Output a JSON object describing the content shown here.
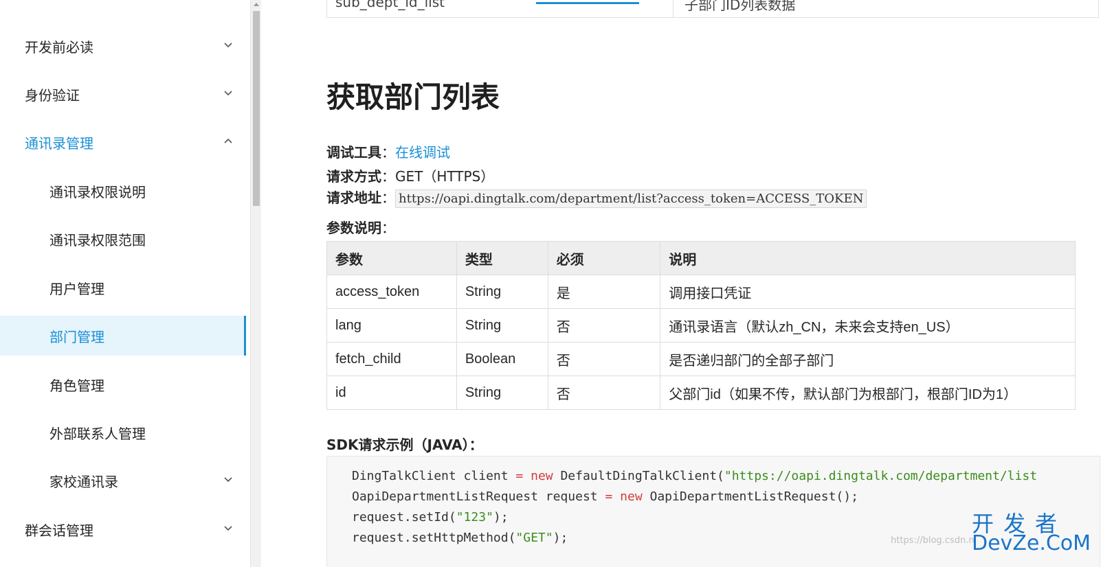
{
  "sidebar": {
    "items": [
      {
        "label": "开发前必读",
        "chevron": "down"
      },
      {
        "label": "身份验证",
        "chevron": "down"
      },
      {
        "label": "通讯录管理",
        "chevron": "up"
      },
      {
        "label": "通讯录权限说明"
      },
      {
        "label": "通讯录权限范围"
      },
      {
        "label": "用户管理"
      },
      {
        "label": "部门管理"
      },
      {
        "label": "角色管理"
      },
      {
        "label": "外部联系人管理"
      },
      {
        "label": "家校通讯录",
        "chevron": "down"
      },
      {
        "label": "群会话管理",
        "chevron": "down"
      }
    ]
  },
  "prev_table": {
    "param": "sub_dept_id_list",
    "desc": "子部门ID列表数据"
  },
  "main": {
    "title": "获取部门列表",
    "debug_tool_label": "调试工具",
    "debug_tool_link": "在线调试",
    "method_label": "请求方式",
    "method_value": "GET（HTTPS）",
    "url_label": "请求地址",
    "url_value": "https://oapi.dingtalk.com/department/list?access_token=ACCESS_TOKEN",
    "params_label": "参数说明",
    "sdk_heading": "SDK请求示例（JAVA）："
  },
  "param_table": {
    "headers": [
      "参数",
      "类型",
      "必须",
      "说明"
    ],
    "rows": [
      [
        "access_token",
        "String",
        "是",
        "调用接口凭证"
      ],
      [
        "lang",
        "String",
        "否",
        "通讯录语言（默认zh_CN，未来会支持en_US）"
      ],
      [
        "fetch_child",
        "Boolean",
        "否",
        "是否递归部门的全部子部门"
      ],
      [
        "id",
        "String",
        "否",
        "父部门id（如果不传，默认部门为根部门，根部门ID为1）"
      ]
    ]
  },
  "code": {
    "line1_a": "DingTalkClient client ",
    "line1_op": "=",
    "line1_b": " ",
    "line1_kw": "new",
    "line1_c": " DefaultDingTalkClient(",
    "line1_str": "\"https://oapi.dingtalk.com/department/list",
    "line2_a": "OapiDepartmentListRequest request ",
    "line2_op": "=",
    "line2_b": " ",
    "line2_kw": "new",
    "line2_c": " OapiDepartmentListRequest();",
    "line3_a": "request.setId(",
    "line3_str": "\"123\"",
    "line3_b": ");",
    "line4_a": "request.setHttpMethod(",
    "line4_str": "\"GET\"",
    "line4_b": ");"
  },
  "watermark": {
    "url": "https://blog.csdn.n",
    "cn": "开发者",
    "en": "DevZe.CoM"
  },
  "colors": {
    "accent": "#1a8fd6",
    "active_bg": "#e6f4fc",
    "keyword": "#d23b3b",
    "string": "#3c8c1f"
  }
}
